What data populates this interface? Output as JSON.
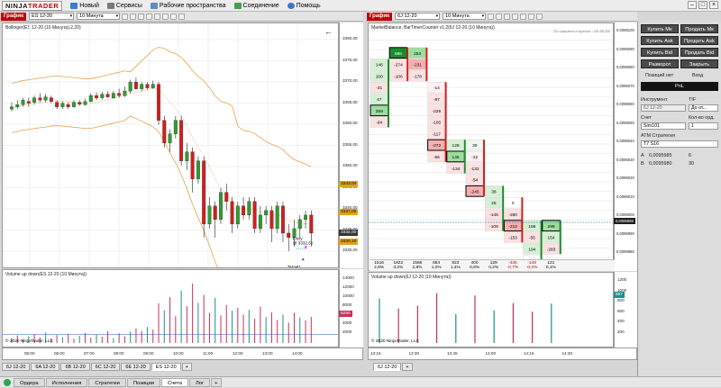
{
  "app": {
    "logo_part1": "NINJA",
    "logo_part2": "TRADER",
    "menu": [
      {
        "label": "Новый",
        "icon": "new-icon"
      },
      {
        "label": "Сервисы",
        "icon": "tools-icon"
      },
      {
        "label": "Рабочие пространства",
        "icon": "workspace-icon"
      },
      {
        "label": "Соединение",
        "icon": "connection-icon"
      },
      {
        "label": "Помощь",
        "icon": "help-icon"
      }
    ]
  },
  "colors": {
    "up": "#2e9e2e",
    "down": "#d51d1d",
    "accent": "#c00000",
    "band": "#e8a04a",
    "price_gold": "#e0a31a",
    "price_teal": "#2a8a8a",
    "volume_down_bar": "#c8305a",
    "volume_up_bar": "#1d8f8f"
  },
  "left_chart": {
    "tag": "График",
    "instrument": "ES 12-20",
    "interval": "10 Минута",
    "indicator": "Bollinger(ES 12-20 (10 Минута),2,20)",
    "price_axis": [
      "3380,00",
      "3375,00",
      "3370,00",
      "3365,00",
      "3360,00",
      "3355,00",
      "3350,00",
      "3345,00",
      "3340,00",
      "3335,00",
      "3330,00"
    ],
    "price_markers": [
      {
        "label": "3343,04",
        "color": "#e0a31a"
      },
      {
        "label": "3337,00",
        "color": "#e0a31a"
      },
      {
        "label": "3332,00",
        "color": "#333333"
      },
      {
        "label": "3330,10",
        "color": "#e0a31a"
      }
    ],
    "entry_label": "Entry",
    "entry_price": "@ 3332,50",
    "target_label": "Target1",
    "target_price": "@ 3330,75",
    "volume_title": "Volume up down(ES 12-20 (10 Минута))",
    "volume_axis": [
      "14000",
      "12000",
      "10000",
      "8000",
      "6000",
      "4000",
      "2000"
    ],
    "volume_marker": "6250",
    "time_axis": [
      "05:00",
      "06:00",
      "07:00",
      "08:00",
      "09:00",
      "10:00",
      "11:00",
      "12:00",
      "13:00",
      "14:00"
    ],
    "copyright": "© 2020 NinjaTrader, LLC",
    "tabs": [
      "6J 12-20",
      "6A 12-20",
      "6B 12-20",
      "6C 12-20",
      "6E 12-20",
      "ES 12-20"
    ],
    "active_tab": "ES 12-20",
    "add_tab": "+"
  },
  "right_chart": {
    "tag": "График",
    "instrument": "6J 12-20",
    "interval": "10 Минута",
    "indicator": "MarketBalance, BarTimerCounter v1.2(6J 12-20 (10 Минута))",
    "timer": "Оставшееся время =00:00:52",
    "price_axis": [
      "0,0096100",
      "0,0096090",
      "0,0096080",
      "0,0096070",
      "0,0096060",
      "0,0096050",
      "0,0096040",
      "0,0096030",
      "0,0096020",
      "0,0096010",
      "0,0096000",
      "0,0095990",
      "0,0095980"
    ],
    "price_marker": "0,0095998",
    "totals": [
      {
        "value": "1516",
        "pct": "2,8%"
      },
      {
        "value": "1822",
        "pct": "3,2%"
      },
      {
        "value": "1566",
        "pct": "2,8%"
      },
      {
        "value": "684",
        "pct": "1,2%"
      },
      {
        "value": "823",
        "pct": "1,4%"
      },
      {
        "value": "400",
        "pct": "0,6%"
      },
      {
        "value": "129",
        "pct": "0,2%"
      },
      {
        "value": "-436",
        "pct": "-0,7%"
      },
      {
        "value": "-149",
        "pct": "-0,2%"
      },
      {
        "value": "121",
        "pct": "0,1%"
      }
    ],
    "volume_title": "Volume up down(6J 12-20 (10 Минута))",
    "volume_axis": [
      "1200",
      "1000",
      "800",
      "600",
      "400",
      "200"
    ],
    "volume_marker": "867",
    "time_axis": [
      "13:15",
      "13:30",
      "13:45",
      "14:00",
      "14:15",
      "14:30"
    ],
    "copyright": "© 2020 NinjaTrader, LLC",
    "tabs": [
      "6J 12-20"
    ],
    "add_tab": "+",
    "footprint": [
      {
        "col": 0,
        "cells": [
          {
            "v": "146",
            "s": "up"
          },
          {
            "v": "100",
            "s": "up"
          },
          {
            "v": "-31",
            "s": "dn"
          },
          {
            "v": "47",
            "s": "up"
          },
          {
            "v": "269",
            "s": "up2",
            "box": true
          },
          {
            "v": "-84",
            "s": "dn"
          }
        ]
      },
      {
        "col": 1,
        "cells": [
          {
            "v": "686",
            "s": "up3",
            "box": true
          },
          {
            "v": "-274",
            "s": "dn"
          },
          {
            "v": "-106",
            "s": "dn"
          }
        ]
      },
      {
        "col": 2,
        "cells": [
          {
            "v": "253",
            "s": "up2"
          },
          {
            "v": "-231",
            "s": "dn2"
          },
          {
            "v": "-178",
            "s": "dn"
          }
        ]
      },
      {
        "col": 3,
        "cells": [
          {
            "v": "-14",
            "s": "dn0"
          },
          {
            "v": "-87",
            "s": "dn"
          },
          {
            "v": "-226",
            "s": "dn"
          },
          {
            "v": "-100",
            "s": "dn"
          },
          {
            "v": "-117",
            "s": "dn"
          },
          {
            "v": "-272",
            "s": "dn2",
            "box": true
          },
          {
            "v": "-56",
            "s": "dn"
          }
        ]
      },
      {
        "col": 4,
        "cells": [
          {
            "v": "128",
            "s": "up"
          },
          {
            "v": "145",
            "s": "up2",
            "box": true
          },
          {
            "v": "-134",
            "s": "dn"
          }
        ]
      },
      {
        "col": 5,
        "cells": [
          {
            "v": "30",
            "s": "up0"
          },
          {
            "v": "-22",
            "s": "dn0"
          },
          {
            "v": "-132",
            "s": "dn"
          },
          {
            "v": "-54",
            "s": "dn"
          },
          {
            "v": "-245",
            "s": "dn2",
            "box": true
          }
        ]
      },
      {
        "col": 6,
        "cells": [
          {
            "v": "38",
            "s": "up"
          },
          {
            "v": "25",
            "s": "up"
          },
          {
            "v": "-145",
            "s": "dn"
          },
          {
            "v": "-109",
            "s": "dn"
          }
        ]
      },
      {
        "col": 7,
        "cells": [
          {
            "v": "0",
            "s": "nt"
          },
          {
            "v": "-260",
            "s": "dn"
          },
          {
            "v": "-212",
            "s": "dn2",
            "box": true
          },
          {
            "v": "-153",
            "s": "dn"
          }
        ]
      },
      {
        "col": 8,
        "cells": [
          {
            "v": "158",
            "s": "up"
          },
          {
            "v": "-55",
            "s": "dn"
          },
          {
            "v": "194",
            "s": "up"
          },
          {
            "v": "-8",
            "s": "nt"
          }
        ]
      },
      {
        "col": 9,
        "cells": [
          {
            "v": "299",
            "s": "up2",
            "box": true
          },
          {
            "v": "154",
            "s": "up"
          },
          {
            "v": "-283",
            "s": "dn"
          }
        ]
      }
    ]
  },
  "control_panel": {
    "buttons": [
      "Купить Мк",
      "Продать Мк",
      "Купить Ask",
      "Продать Ask",
      "Купить Bid",
      "Продать Bid",
      "Разворот",
      "Закрыть"
    ],
    "position_label": "Позиций нет",
    "entry_label": "Вход",
    "pnl_label": "PnL",
    "instrument_label": "Инструмент",
    "tif_label": "TIF",
    "instrument_value": "6J 12-20",
    "tif_value": "До от...",
    "account_label": "Счет",
    "qty_label": "Кол-во орд.",
    "account_value": "Sim101",
    "qty_value": "1",
    "atm_label": "ATM Стратегия",
    "atm_value": "T7 S16",
    "ask_label": "A",
    "ask_price": "0,0095985",
    "ask_size": "6",
    "bid_label": "B",
    "bid_price": "0,0095980",
    "bid_size": "30"
  },
  "status_tabs": [
    "Ордера",
    "Исполнения",
    "Стратегии",
    "Позиции",
    "Счета",
    "Лог"
  ],
  "status_active": "Счета"
}
